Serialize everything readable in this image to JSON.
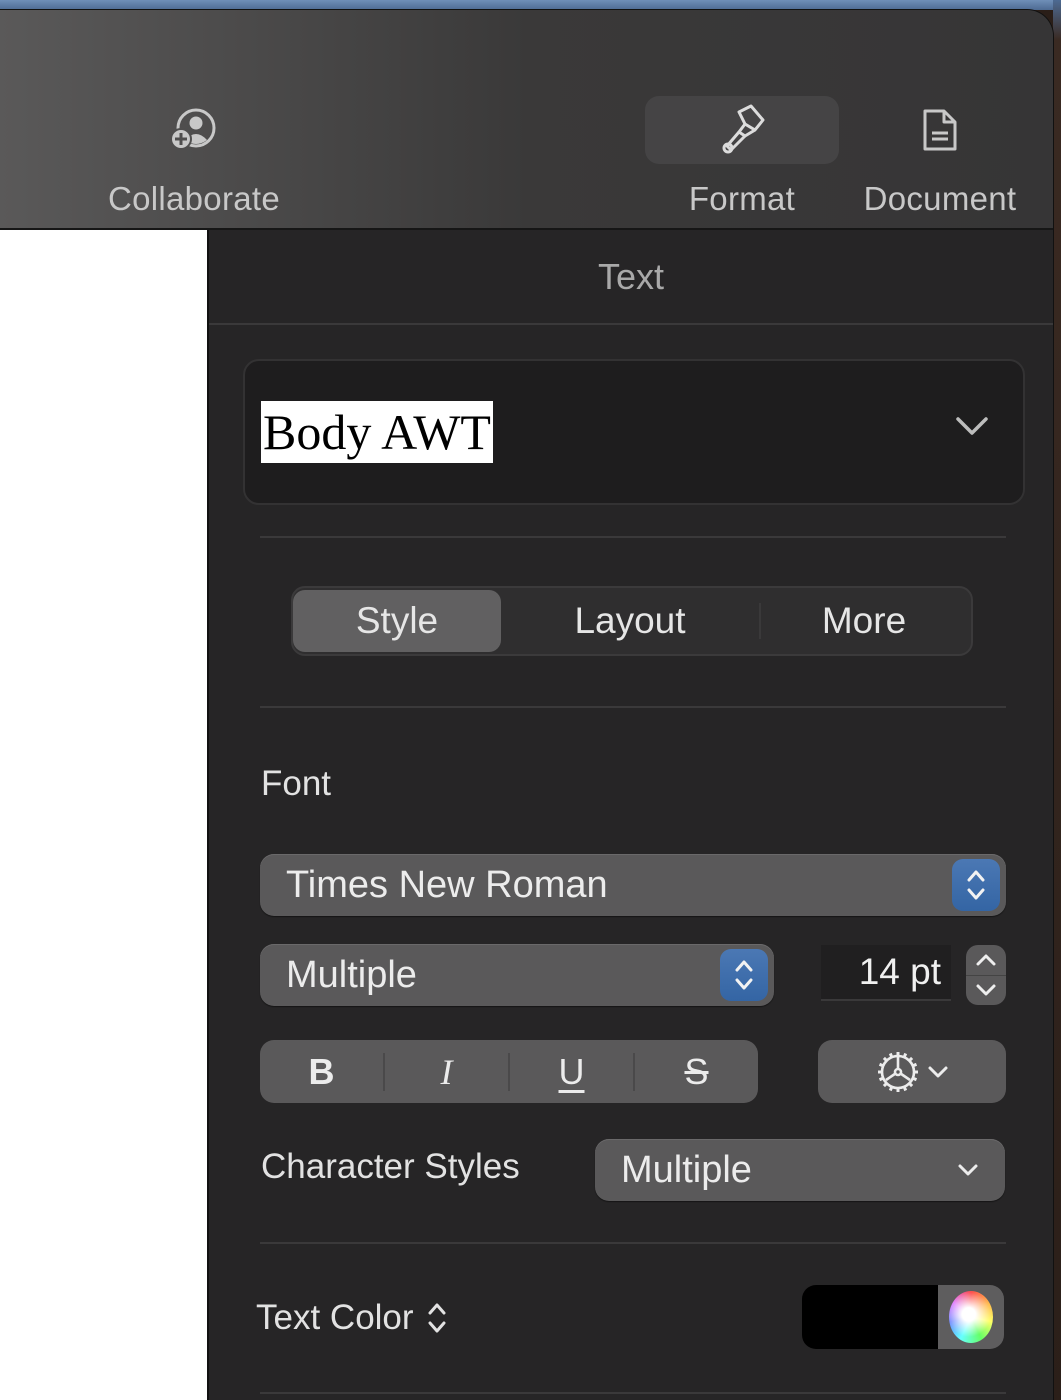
{
  "toolbar": {
    "items": [
      {
        "label": "Collaborate",
        "icon": "collaborate-person-plus-icon",
        "active": false
      },
      {
        "label": "Format",
        "icon": "paintbrush-icon",
        "active": true
      },
      {
        "label": "Document",
        "icon": "document-icon",
        "active": false
      }
    ]
  },
  "inspector": {
    "title": "Text",
    "paragraph_style": {
      "value": "Body AWT",
      "icon": "chevron-down-icon"
    },
    "tabs": [
      {
        "label": "Style",
        "active": true
      },
      {
        "label": "Layout",
        "active": false
      },
      {
        "label": "More",
        "active": false
      }
    ],
    "font": {
      "section_label": "Font",
      "family": "Times New Roman",
      "typeface": "Multiple",
      "size": "14 pt",
      "style_buttons": [
        {
          "label": "B",
          "name": "bold"
        },
        {
          "label": "I",
          "name": "italic"
        },
        {
          "label": "U",
          "name": "underline"
        },
        {
          "label": "S",
          "name": "strikethrough"
        }
      ],
      "options_icon": "gear-icon",
      "character_styles_label": "Character Styles",
      "character_styles_value": "Multiple"
    },
    "text_color": {
      "label": "Text Color",
      "color": "#000000"
    }
  },
  "colors": {
    "accent_blue": "#3a6aa8"
  }
}
